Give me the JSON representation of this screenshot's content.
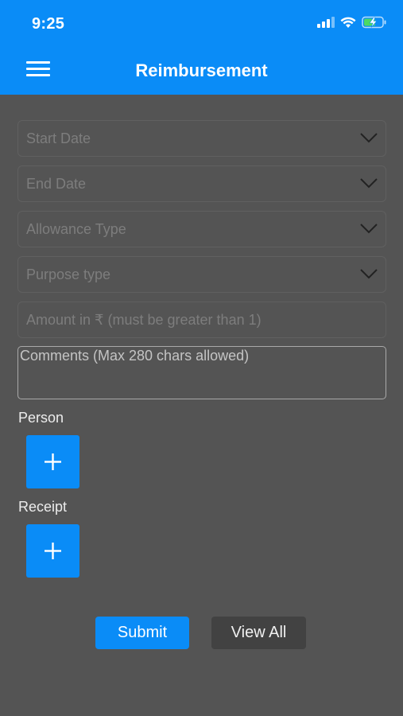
{
  "status_bar": {
    "time": "9:25",
    "icons": [
      "cellular-signal-icon",
      "wifi-icon",
      "battery-charging-icon"
    ],
    "battery_color": "#4cd964"
  },
  "header": {
    "title": "Reimbursement",
    "menu_icon": "hamburger-menu-icon",
    "background": "#0a8cf7"
  },
  "form": {
    "start_date": {
      "placeholder": "Start Date",
      "icon": "chevron-down-icon"
    },
    "end_date": {
      "placeholder": "End Date",
      "icon": "chevron-down-icon"
    },
    "allowance_type": {
      "placeholder": "Allowance Type",
      "icon": "chevron-down-icon"
    },
    "purpose_type": {
      "placeholder": "Purpose type",
      "icon": "chevron-down-icon"
    },
    "amount": {
      "placeholder": "Amount in ₹ (must be greater than 1)"
    },
    "comments": {
      "placeholder": "Comments (Max 280 chars allowed)"
    }
  },
  "person": {
    "label": "Person",
    "add_icon": "plus-icon"
  },
  "receipt": {
    "label": "Receipt",
    "add_icon": "plus-icon"
  },
  "actions": {
    "submit_label": "Submit",
    "view_all_label": "View All"
  },
  "colors": {
    "accent": "#0a8cf7",
    "background": "#545454",
    "secondary_button": "#424242"
  }
}
